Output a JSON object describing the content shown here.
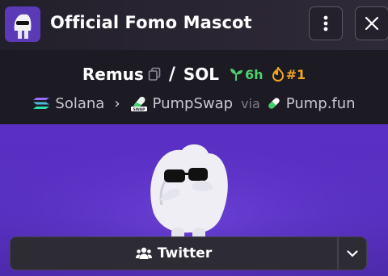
{
  "header": {
    "title": "Official Fomo Mascot",
    "more_icon": "vertical-dots-icon",
    "close_icon": "close-icon"
  },
  "pair": {
    "base": "Remus",
    "separator": "/",
    "quote": "SOL",
    "age": "6h",
    "rank": "#1",
    "age_color": "#4fcf6f",
    "rank_color": "#f5a623"
  },
  "route": {
    "chain": "Solana",
    "dex": "PumpSwap",
    "via_label": "via",
    "launchpad": "Pump.fun",
    "chevron": "›"
  },
  "actions": {
    "twitter_label": "Twitter",
    "twitter_icon": "users-icon",
    "dropdown_icon": "chevron-down-icon"
  }
}
